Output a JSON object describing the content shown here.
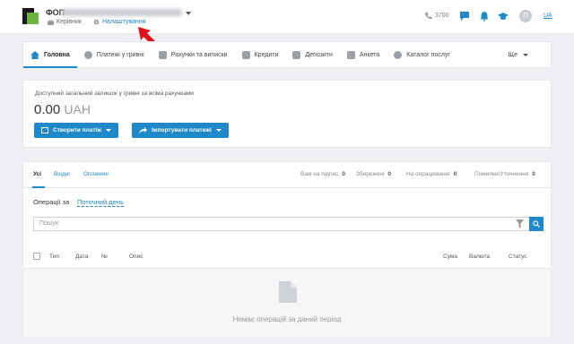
{
  "header": {
    "company": "ФОП",
    "role": "Керівник",
    "settings": "Налаштування",
    "phone": "3700",
    "avatar_initial": "П",
    "lang": "UA"
  },
  "nav": {
    "items": [
      {
        "label": "Головна",
        "icon": "home-icon"
      },
      {
        "label": "Платежі у гривні",
        "icon": "hryvnia-icon"
      },
      {
        "label": "Рахунки та виписки",
        "icon": "document-icon"
      },
      {
        "label": "Кредити",
        "icon": "bank-icon"
      },
      {
        "label": "Депозити",
        "icon": "deposit-icon"
      },
      {
        "label": "Анкета",
        "icon": "form-icon"
      },
      {
        "label": "Каталог послуг",
        "icon": "catalog-icon"
      }
    ],
    "more": "Ще"
  },
  "balance": {
    "label": "Доступний загальний залишок у гривні за всіма рахунками",
    "amount": "0.00",
    "currency": "UAH",
    "create_button": "Створити платіж",
    "import_button": "Імпортувати платежі"
  },
  "operations": {
    "tabs": [
      "Усі",
      "Вхідні",
      "Оплачені"
    ],
    "stats": [
      {
        "label": "Вам на підпис",
        "count": "0"
      },
      {
        "label": "Збережені",
        "count": "0"
      },
      {
        "label": "На опрацюванні",
        "count": "0"
      },
      {
        "label": "Помилки/Уточнення",
        "count": "0"
      }
    ],
    "period_label": "Операції за",
    "period_value": "Поточний день",
    "search_placeholder": "Пошук",
    "columns": [
      "Тип",
      "Дата",
      "№",
      "Опис",
      "Сума",
      "Валюта",
      "Статус"
    ],
    "empty_text": "Немає операцій за даний період"
  },
  "colors": {
    "accent": "#1e88c9",
    "logo_green": "#6bb43f",
    "annotation_arrow": "#e0101a"
  }
}
